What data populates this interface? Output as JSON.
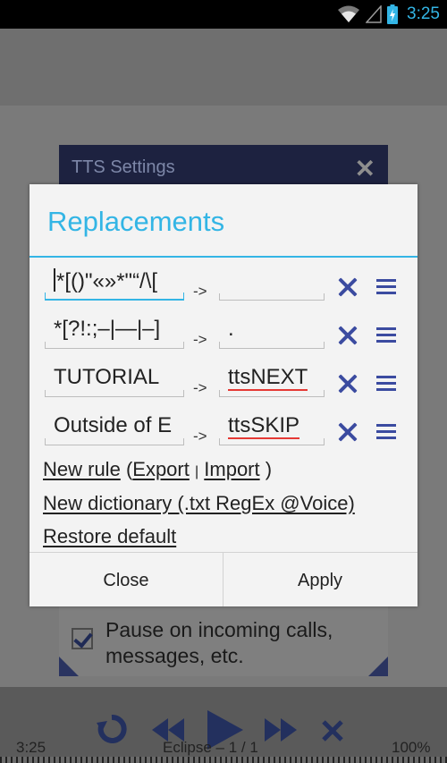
{
  "status_bar": {
    "time": "3:25",
    "icons": [
      "wifi-icon",
      "signal-icon",
      "battery-charging-icon"
    ]
  },
  "background_dialog": {
    "title": "TTS Settings",
    "close_icon": "close-icon",
    "pause_label": "Pause on incoming calls, messages, etc.",
    "pause_checked": true
  },
  "player": {
    "time": "3:25",
    "book": "Eclipse – 1 / 1",
    "zoom": "100%",
    "icons": [
      "rotate-icon",
      "rewind-icon",
      "play-icon",
      "fast-forward-icon",
      "stop-icon"
    ]
  },
  "dialog": {
    "title": "Replacements",
    "rules": [
      {
        "pattern": "*[()\"«»*\"“/\\[",
        "replacement": "",
        "active": true
      },
      {
        "pattern": "*[?!:;–|—|–]",
        "replacement": ".",
        "active": false
      },
      {
        "pattern": "TUTORIAL",
        "replacement": "ttsNEXT",
        "active": false
      },
      {
        "pattern": "Outside of E",
        "replacement": "ttsSKIP",
        "active": false
      }
    ],
    "arrow": "->",
    "new_rule": "New rule",
    "open_paren": "(",
    "export": "Export",
    "separator": "|",
    "import": "Import",
    "close_paren": ")",
    "new_dictionary": "New dictionary (.txt RegEx @Voice)",
    "restore_default": "Restore default",
    "close_button": "Close",
    "apply_button": "Apply"
  },
  "colors": {
    "accent": "#33b5e5",
    "icon": "#3b4ba0",
    "spellcheck": "#e53935"
  }
}
